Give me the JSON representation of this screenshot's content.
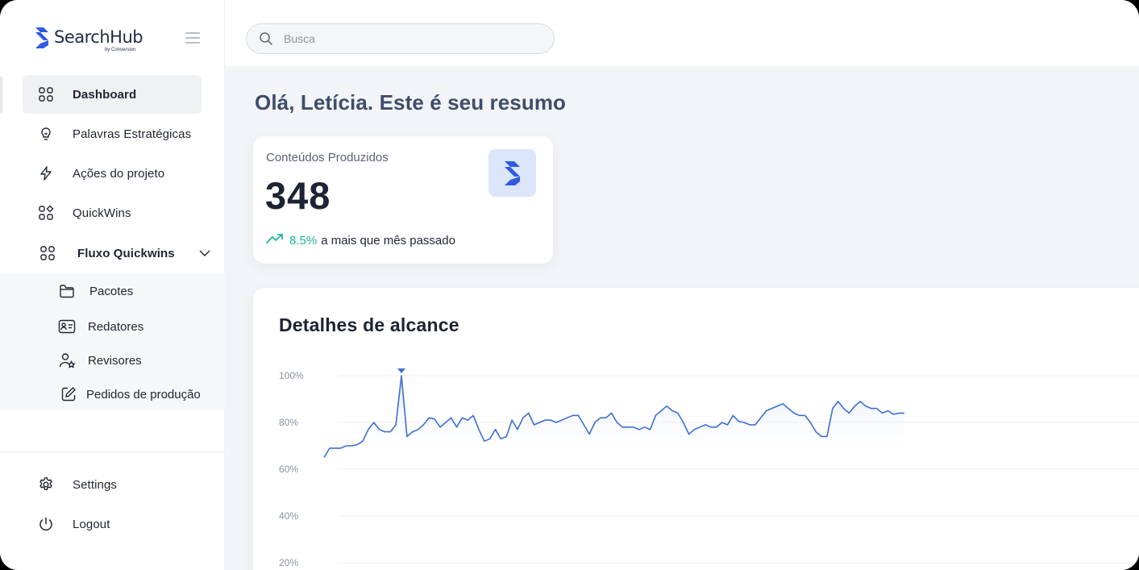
{
  "app": {
    "brand": "SearchHub",
    "brand_sub": "by Conversion",
    "accent": "#2f5be0"
  },
  "search": {
    "placeholder": "Busca"
  },
  "sidebar": {
    "items": [
      {
        "label": "Dashboard",
        "icon": "grid-icon",
        "active": true
      },
      {
        "label": "Palavras Estratégicas",
        "icon": "lightbulb-icon"
      },
      {
        "label": "Ações do projeto",
        "icon": "lightning-icon"
      },
      {
        "label": "QuickWins",
        "icon": "apps-icon"
      },
      {
        "label": "Fluxo Quickwins",
        "icon": "grid-icon",
        "expanded": true
      }
    ],
    "subitems": [
      {
        "label": "Pacotes",
        "icon": "folder-icon"
      },
      {
        "label": "Redatores",
        "icon": "id-card-icon"
      },
      {
        "label": "Revisores",
        "icon": "user-star-icon"
      },
      {
        "label": "Pedidos de produção",
        "icon": "edit-icon"
      }
    ],
    "bottom": [
      {
        "label": "Settings",
        "icon": "gear-icon"
      },
      {
        "label": "Logout",
        "icon": "power-icon"
      }
    ]
  },
  "main": {
    "greeting": "Olá, Letícia. Este é seu resumo",
    "kpi": {
      "title": "Conteúdos Produzidos",
      "value": "348",
      "trend_pct": "8.5%",
      "trend_text": "a mais que mês passado",
      "trend_color": "#1fb59a"
    },
    "chart_title": "Detalhes de alcance"
  },
  "chart_data": {
    "type": "area",
    "title": "Detalhes de alcance",
    "y_ticks": [
      "100%",
      "80%",
      "60%",
      "40%",
      "20%"
    ],
    "ylim": [
      20,
      100
    ],
    "grid": true,
    "color": "#3c6fd1",
    "peak_marker_index": 14,
    "values": [
      65,
      69,
      69,
      69,
      70,
      70,
      70.5,
      72,
      77,
      80,
      77,
      76,
      76,
      79,
      100,
      74,
      76,
      77,
      79,
      82,
      81.5,
      78,
      80,
      82,
      78,
      82,
      81,
      83,
      77,
      72,
      73,
      77,
      73,
      74,
      81,
      77,
      82,
      84,
      79,
      80,
      81,
      81,
      80,
      81,
      82,
      83,
      83,
      79,
      75,
      80,
      82,
      82,
      84,
      80,
      78,
      78,
      78,
      77,
      78,
      77,
      83,
      85,
      87,
      85,
      84,
      80,
      75,
      77,
      78,
      79,
      78,
      78,
      80,
      79,
      83,
      80.5,
      80,
      79,
      79,
      82,
      85,
      86,
      87,
      88,
      86,
      84,
      83,
      83,
      80,
      76,
      74,
      74,
      86,
      89,
      86,
      84,
      87,
      89,
      87,
      86,
      86,
      84,
      85,
      83.5,
      84,
      84
    ]
  }
}
